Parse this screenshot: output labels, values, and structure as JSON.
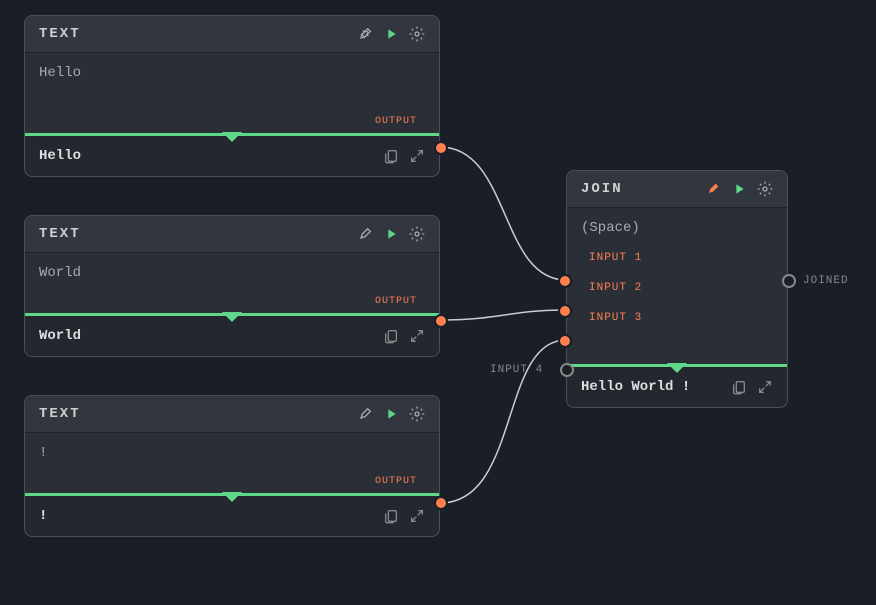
{
  "nodes": {
    "text1": {
      "title": "TEXT",
      "input": "Hello",
      "output_label": "OUTPUT",
      "result": "Hello"
    },
    "text2": {
      "title": "TEXT",
      "input": "World",
      "output_label": "OUTPUT",
      "result": "World"
    },
    "text3": {
      "title": "TEXT",
      "input": "!",
      "output_label": "OUTPUT",
      "result": "!"
    },
    "join": {
      "title": "JOIN",
      "separator": "(Space)",
      "inputs": [
        "INPUT 1",
        "INPUT 2",
        "INPUT 3",
        "INPUT 4"
      ],
      "output_label": "JOINED",
      "result": "Hello World !"
    }
  },
  "colors": {
    "accent_orange": "#ff7f50",
    "accent_green": "#5fd88a",
    "node_bg": "#2a2e37",
    "canvas_bg": "#1a1e27"
  }
}
